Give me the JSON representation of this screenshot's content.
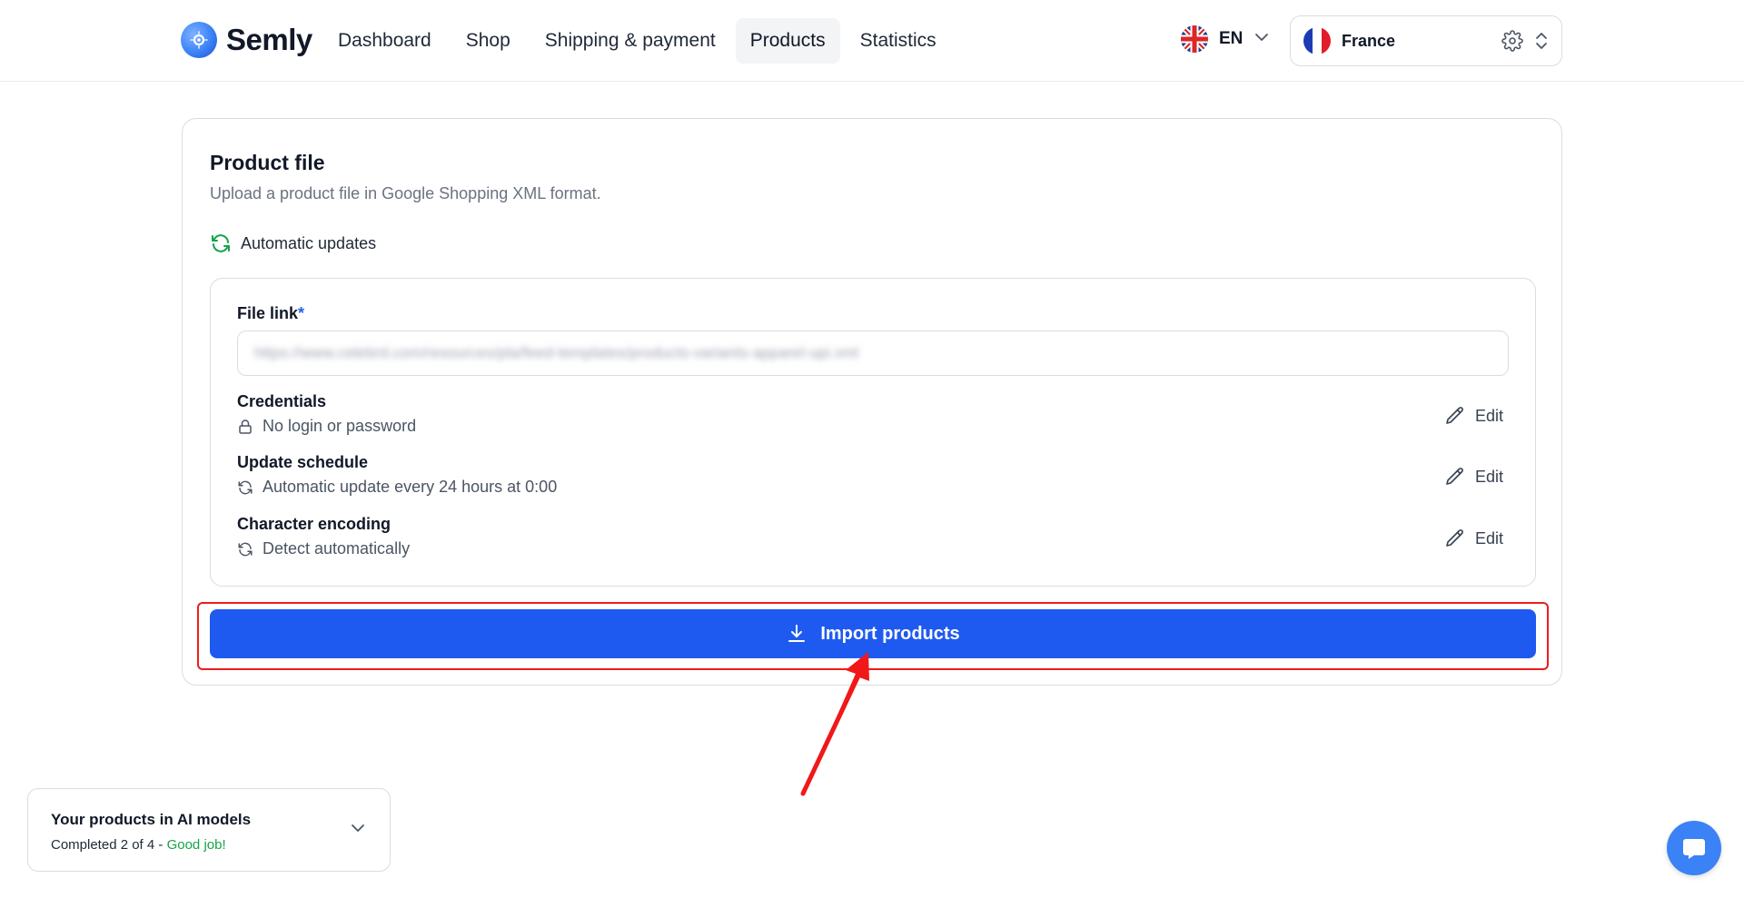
{
  "header": {
    "brand": "Semly",
    "nav": [
      {
        "label": "Dashboard",
        "active": false
      },
      {
        "label": "Shop",
        "active": false
      },
      {
        "label": "Shipping & payment",
        "active": false
      },
      {
        "label": "Products",
        "active": true
      },
      {
        "label": "Statistics",
        "active": false
      }
    ],
    "language": {
      "code": "EN",
      "icon": "uk-flag-icon"
    },
    "country": {
      "name": "France",
      "icon": "france-flag-icon"
    }
  },
  "card": {
    "title": "Product file",
    "subtitle": "Upload a product file in Google Shopping XML format.",
    "auto_updates_label": "Automatic updates",
    "file_link": {
      "label": "File link",
      "required_mark": "*",
      "value": "https://www.celebrd.com/resources/pla/feed-templates/products-variants-apparel-upi.xml"
    },
    "settings": [
      {
        "title": "Credentials",
        "value": "No login or password",
        "icon": "lock-icon",
        "edit_label": "Edit"
      },
      {
        "title": "Update schedule",
        "value": "Automatic update every 24 hours at 0:00",
        "icon": "refresh-icon",
        "edit_label": "Edit"
      },
      {
        "title": "Character encoding",
        "value": "Detect automatically",
        "icon": "refresh-icon",
        "edit_label": "Edit"
      }
    ],
    "import_button": "Import products"
  },
  "ai_widget": {
    "title": "Your products in AI models",
    "progress_text": "Completed 2 of 4 - ",
    "progress_done": 2,
    "progress_total": 4,
    "praise": "Good job!"
  },
  "colors": {
    "primary": "#1f5af0",
    "highlight": "#ef1c1c",
    "success": "#16a34a"
  }
}
